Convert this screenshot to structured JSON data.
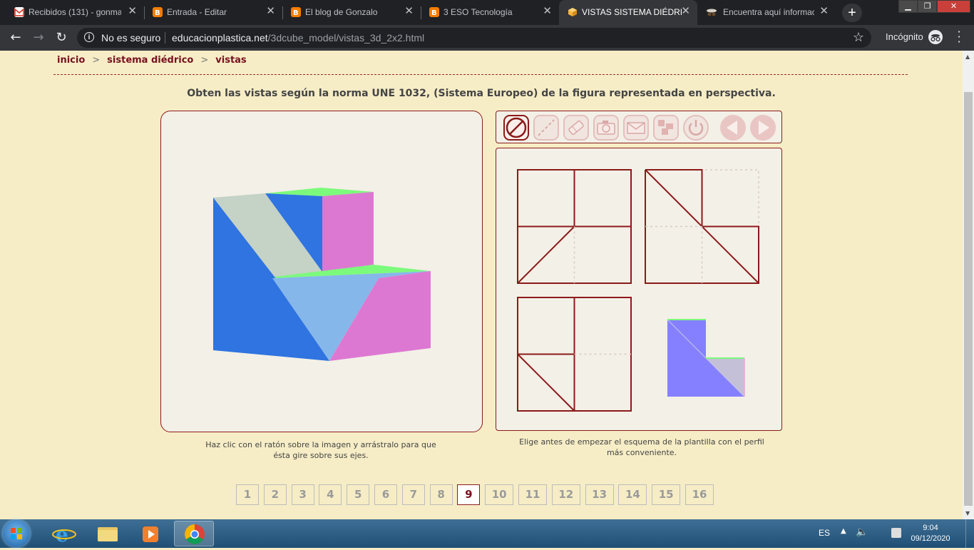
{
  "browser": {
    "tabs": [
      {
        "title": "Recibidos (131) - gonma",
        "icon": "gmail-icon",
        "active": false
      },
      {
        "title": "Entrada - Editar",
        "icon": "blogger-icon",
        "active": false
      },
      {
        "title": "El blog de Gonzalo",
        "icon": "blogger-icon",
        "active": false
      },
      {
        "title": "3 ESO Tecnología",
        "icon": "blogger-icon",
        "active": false
      },
      {
        "title": "VISTAS SISTEMA DIÉDRI",
        "icon": "cube-icon",
        "active": true
      },
      {
        "title": "Encuentra aquí informac",
        "icon": "incognito-icon",
        "active": false
      }
    ],
    "security_label": "No es seguro",
    "url_host": "educacionplastica.net",
    "url_path": "/3dcube_model/vistas_3d_2x2.html",
    "incognito_label": "Incógnito"
  },
  "breadcrumb": [
    "inicio",
    "sistema diédrico",
    "vistas"
  ],
  "instruction": "Obten las vistas según la norma UNE 1032, (Sistema Europeo) de la figura representada en perspectiva.",
  "perspective_caption": "Haz clic con el ratón sobre la imagen y arrástralo para que ésta gire sobre sus ejes.",
  "views_caption": "Elige antes de empezar el esquema de la plantilla con el perfil más conveniente.",
  "tools": [
    "pencil-line-icon",
    "dashed-line-icon",
    "eraser-icon",
    "camera-icon",
    "mail-icon",
    "layout-icon",
    "power-icon",
    "prev-arrow-icon",
    "next-arrow-icon"
  ],
  "pager": {
    "pages": [
      "1",
      "2",
      "3",
      "4",
      "5",
      "6",
      "7",
      "8",
      "9",
      "10",
      "11",
      "12",
      "13",
      "14",
      "15",
      "16"
    ],
    "current": "9"
  },
  "colors": {
    "accent": "#8b1a1a",
    "face_blue": "#2f74e0",
    "face_light_blue": "#86b7ea",
    "face_grey": "#c5d2c6",
    "face_green": "#7cfa7c",
    "face_magenta": "#dd78d2",
    "preview_violet": "#8580ff"
  },
  "taskbar": {
    "language": "ES",
    "time": "9:04",
    "date": "09/12/2020"
  }
}
